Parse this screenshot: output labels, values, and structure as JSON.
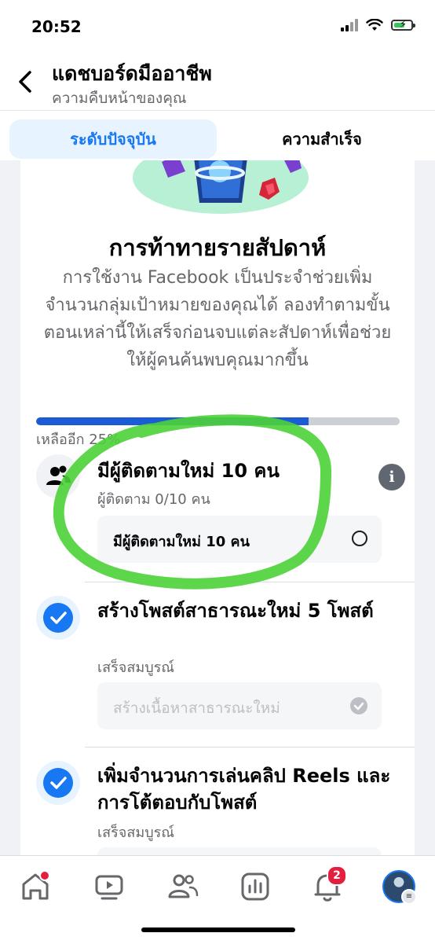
{
  "status_bar": {
    "time": "20:52"
  },
  "header": {
    "title": "แดชบอร์ดมืออาชีพ",
    "subtitle": "ความคืบหน้าของคุณ"
  },
  "tabs": [
    {
      "label": "ระดับปัจจุบัน",
      "selected": true
    },
    {
      "label": "ความสำเร็จ",
      "selected": false
    }
  ],
  "challenge": {
    "title": "การท้าทายรายสัปดาห์",
    "description": "การใช้งาน Facebook เป็นประจำช่วยเพิ่มจำนวนกลุ่มเป้าหมายของคุณได้ ลองทำตามขั้นตอนเหล่านี้ให้เสร็จก่อนจบแต่ละสัปดาห์เพื่อช่วยให้ผู้คนค้นพบคุณมากขึ้น",
    "progress_fraction": 0.75,
    "remaining_label": "เหลืออีก 25%"
  },
  "tasks": [
    {
      "title": "มีผู้ติดตามใหม่ 10 คน",
      "subtitle": "ผู้ติดตาม 0/10 คน",
      "subtask_label": "มีผู้ติดตามใหม่ 10 คน",
      "completed": false
    },
    {
      "title": "สร้างโพสต์สาธารณะใหม่ 5 โพสต์",
      "subtitle": "เสร็จสมบูรณ์",
      "subtask_label": "สร้างเนื้อหาสาธารณะใหม่",
      "completed": true
    },
    {
      "title": "เพิ่มจำนวนการเล่นคลิป Reels และการโต้ตอบกับโพสต์",
      "subtitle": "เสร็จสมบูรณ์",
      "completed": true
    }
  ],
  "bottom_nav": {
    "notifications_badge": "2",
    "items": [
      "home-icon",
      "video-icon",
      "friends-icon",
      "dashboard-icon",
      "bell-icon",
      "profile-avatar"
    ]
  },
  "colors": {
    "accent": "#1877f2",
    "progress": "#1b5cd6",
    "highlight_annotation": "#4cd137",
    "badge": "#e41e3f"
  }
}
